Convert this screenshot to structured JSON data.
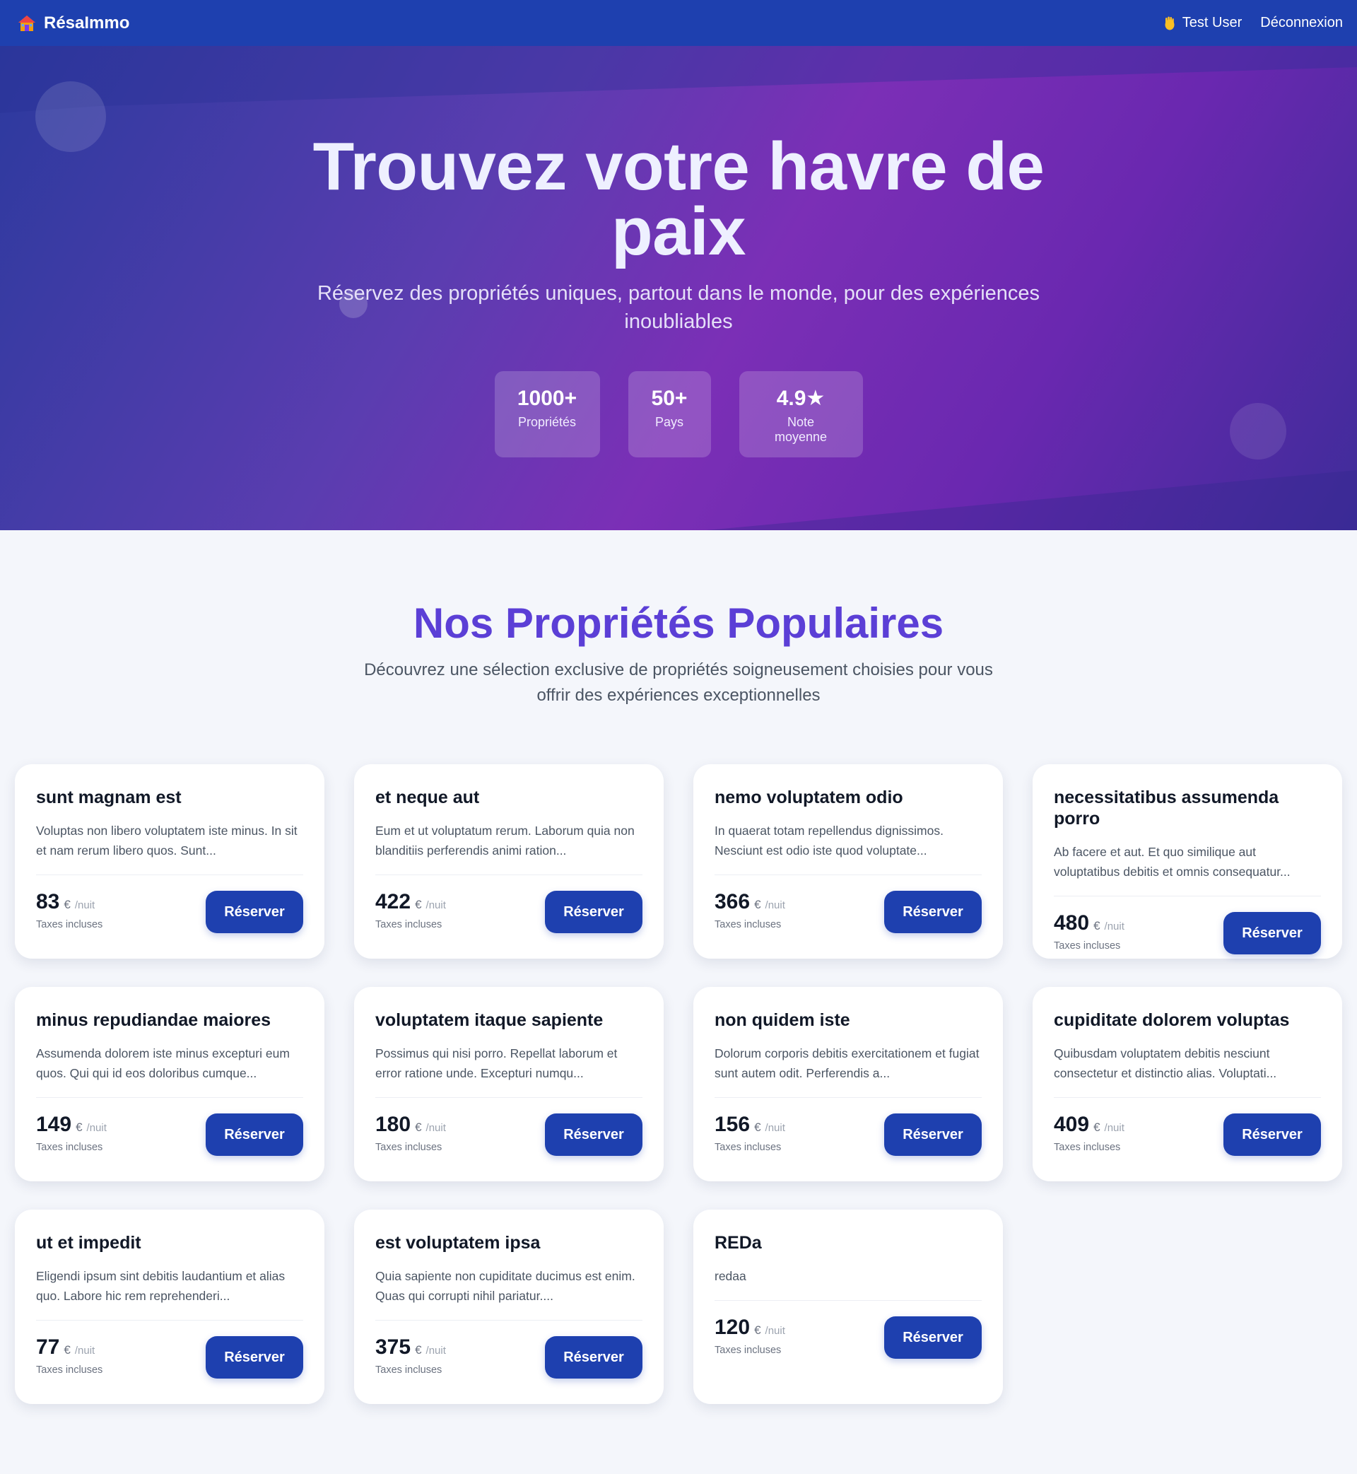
{
  "nav": {
    "brand": "RésaImmo",
    "brand_icon": "house-icon",
    "user_icon": "waving-hand-icon",
    "user_name": "Test User",
    "logout_label": "Déconnexion"
  },
  "hero": {
    "title": "Trouvez votre havre de paix",
    "subtitle": "Réservez des propriétés uniques, partout dans le monde, pour des expériences inoubliables",
    "stats": [
      {
        "value": "1000+",
        "label": "Propriétés"
      },
      {
        "value": "50+",
        "label": "Pays"
      },
      {
        "value": "4.9★",
        "label": "Note moyenne"
      }
    ]
  },
  "section": {
    "title": "Nos Propriétés Populaires",
    "subtitle": "Découvrez une sélection exclusive de propriétés soigneusement choisies pour vous offrir des expériences exceptionnelles"
  },
  "card_labels": {
    "currency": "€",
    "unit": "/nuit",
    "taxes": "Taxes incluses",
    "button": "Réserver"
  },
  "properties": [
    {
      "title": "sunt magnam est",
      "description": "Voluptas non libero voluptatem iste minus. In sit et nam rerum libero quos. Sunt...",
      "price": "83"
    },
    {
      "title": "et neque aut",
      "description": "Eum et ut voluptatum rerum. Laborum quia non blanditiis perferendis animi ration...",
      "price": "422"
    },
    {
      "title": "nemo voluptatem odio",
      "description": "In quaerat totam repellendus dignissimos. Nesciunt est odio iste quod voluptate...",
      "price": "366"
    },
    {
      "title": "necessitatibus assumenda porro",
      "description": "Ab facere et aut. Et quo similique aut voluptatibus debitis et omnis consequatur...",
      "price": "480"
    },
    {
      "title": "minus repudiandae maiores",
      "description": "Assumenda dolorem iste minus excepturi eum quos. Qui qui id eos doloribus cumque...",
      "price": "149"
    },
    {
      "title": "voluptatem itaque sapiente",
      "description": "Possimus qui nisi porro. Repellat laborum et error ratione unde. Excepturi numqu...",
      "price": "180"
    },
    {
      "title": "non quidem iste",
      "description": "Dolorum corporis debitis exercitationem et fugiat sunt autem odit. Perferendis a...",
      "price": "156"
    },
    {
      "title": "cupiditate dolorem voluptas",
      "description": "Quibusdam voluptatem debitis nesciunt consectetur et distinctio alias. Voluptati...",
      "price": "409"
    },
    {
      "title": "ut et impedit",
      "description": "Eligendi ipsum sint debitis laudantium et alias quo. Labore hic rem reprehenderi...",
      "price": "77"
    },
    {
      "title": "est voluptatem ipsa",
      "description": "Quia sapiente non cupiditate ducimus est enim. Quas qui corrupti nihil pariatur....",
      "price": "375"
    },
    {
      "title": "REDa",
      "description": "redaa",
      "price": "120"
    }
  ]
}
